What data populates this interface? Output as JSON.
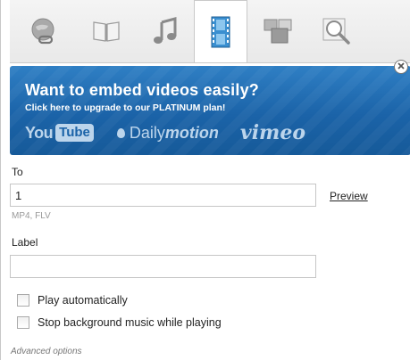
{
  "tabs": [
    {
      "icon": "globe-link-icon"
    },
    {
      "icon": "book-icon"
    },
    {
      "icon": "music-note-icon"
    },
    {
      "icon": "film-icon",
      "active": true
    },
    {
      "icon": "gallery-icon"
    },
    {
      "icon": "magnifier-icon"
    }
  ],
  "banner": {
    "title": "Want to embed videos easily?",
    "subtitle": "Click here to upgrade to our PLATINUM plan!",
    "youtube_you": "You",
    "youtube_tube": "Tube",
    "dailymotion_daily": "Daily",
    "dailymotion_motion": "motion",
    "vimeo": "vimeo"
  },
  "form": {
    "to_label": "To",
    "to_value": "1",
    "preview_label": "Preview",
    "formats_hint": "MP4, FLV",
    "label_label": "Label",
    "label_value": "",
    "play_auto_label": "Play automatically",
    "stop_music_label": "Stop background music while playing",
    "advanced_label": "Advanced options"
  },
  "colors": {
    "banner_blue": "#1b63a8",
    "active_tab_film": "#3a8fd0"
  }
}
